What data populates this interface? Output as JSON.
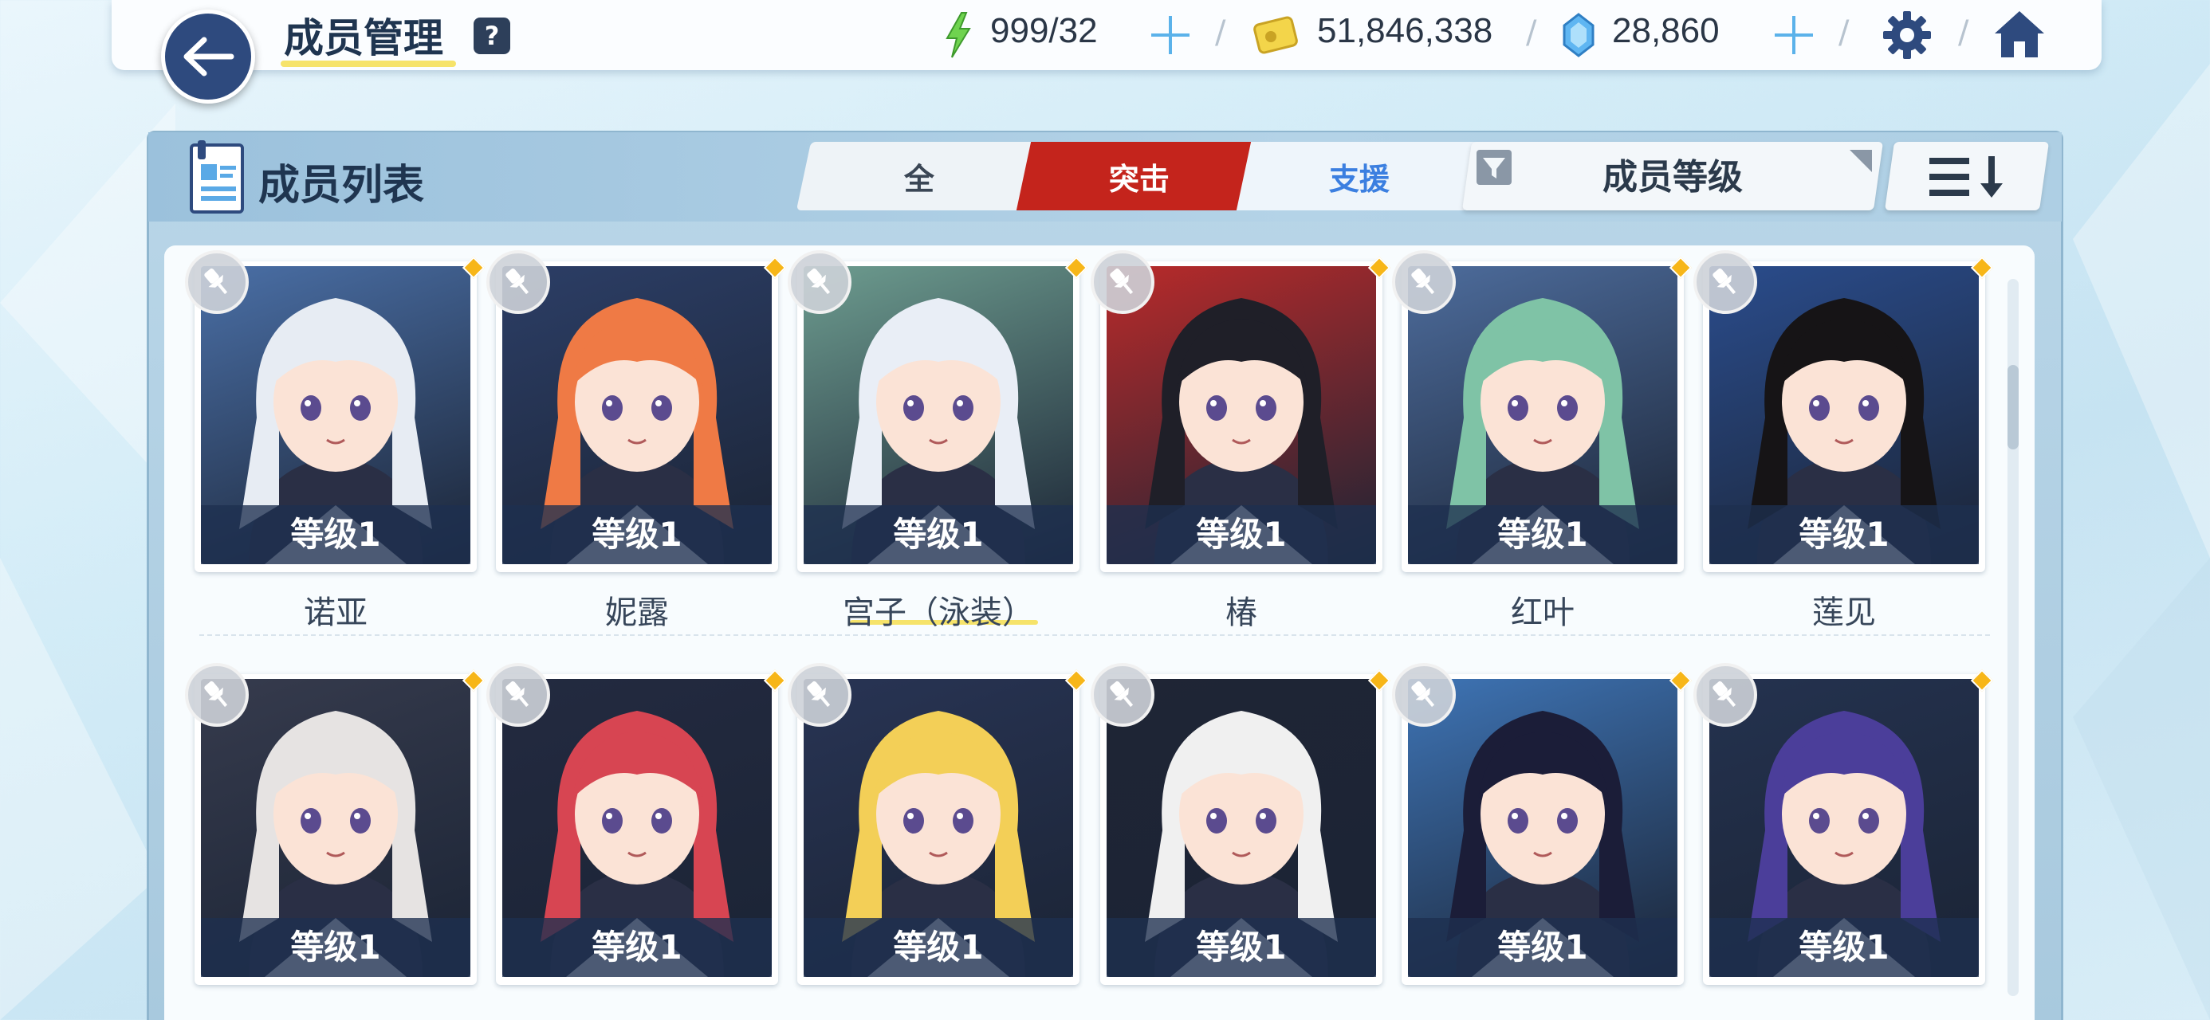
{
  "header": {
    "title": "成员管理",
    "help_label": "?",
    "ap": "999/32",
    "credits": "51,846,338",
    "gems": "28,860"
  },
  "panel": {
    "title": "成员列表",
    "tabs": [
      {
        "label": "全",
        "active": false
      },
      {
        "label": "突击",
        "active": true
      },
      {
        "label": "支援",
        "active": false
      }
    ],
    "sort_field": "成员等级"
  },
  "students": [
    {
      "name": "诺亚",
      "level": "等级1",
      "hair": "#e7ecf3",
      "bg": "#4a6fa6"
    },
    {
      "name": "妮露",
      "level": "等级1",
      "hair": "#ef7a45",
      "bg": "#2c3e66"
    },
    {
      "name": "宫子（泳装）",
      "level": "等级1",
      "hair": "#e9eef6",
      "bg": "#6d9c8f"
    },
    {
      "name": "椿",
      "level": "等级1",
      "hair": "#1f1f28",
      "bg": "#b92a2a"
    },
    {
      "name": "红叶",
      "level": "等级1",
      "hair": "#7fc3a6",
      "bg": "#4d6c9c"
    },
    {
      "name": "莲见",
      "level": "等级1",
      "hair": "#161416",
      "bg": "#2a4c8c"
    },
    {
      "name": "",
      "level": "等级1",
      "hair": "#e6e3e2",
      "bg": "#363b4d"
    },
    {
      "name": "",
      "level": "等级1",
      "hair": "#d74552",
      "bg": "#232a40"
    },
    {
      "name": "",
      "level": "等级1",
      "hair": "#f3cf57",
      "bg": "#283454"
    },
    {
      "name": "",
      "level": "等级1",
      "hair": "#f0f0f0",
      "bg": "#1f2535"
    },
    {
      "name": "",
      "level": "等级1",
      "hair": "#1b1d38",
      "bg": "#3e74b5"
    },
    {
      "name": "",
      "level": "等级1",
      "hair": "#4b3e9a",
      "bg": "#24324f"
    }
  ]
}
